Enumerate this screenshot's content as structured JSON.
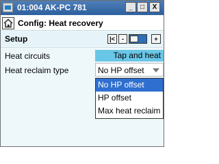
{
  "window": {
    "title": "01:004 AK-PC 781",
    "controls": {
      "minimize": "_",
      "maximize": "□",
      "close": "X"
    }
  },
  "header": {
    "title": "Config: Heat recovery"
  },
  "setup": {
    "label": "Setup",
    "nav": {
      "first": "|<",
      "prev": "<",
      "next": ">",
      "last": ">|"
    }
  },
  "fields": {
    "heat_circuits": {
      "label": "Heat circuits",
      "value": "Tap and heat"
    },
    "heat_reclaim_type": {
      "label": "Heat reclaim type",
      "value": "No HP offset",
      "options": [
        "No HP offset",
        "HP offset",
        "Max heat reclaim"
      ],
      "highlighted_index": 0
    }
  },
  "colors": {
    "titlebar": "#2d5f9f",
    "value_highlight": "#69c6e6",
    "selection": "#2f6fd0"
  }
}
